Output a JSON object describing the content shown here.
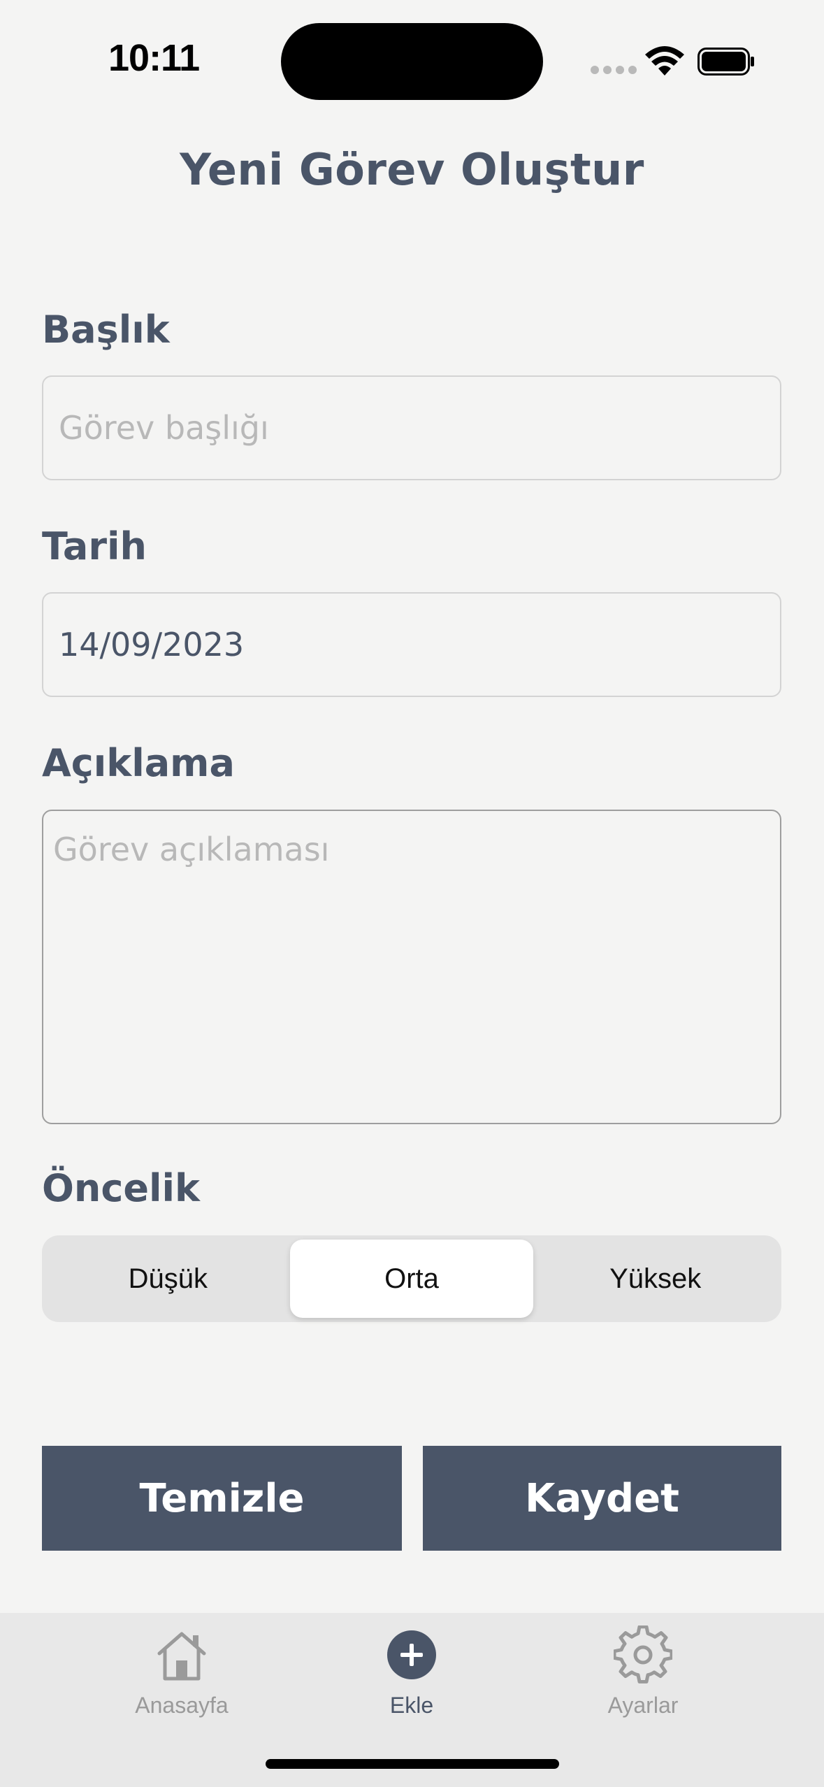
{
  "status_bar": {
    "time": "10:11"
  },
  "header": {
    "title": "Yeni Görev Oluştur"
  },
  "form": {
    "title_label": "Başlık",
    "title_placeholder": "Görev başlığı",
    "date_label": "Tarih",
    "date_value": "14/09/2023",
    "description_label": "Açıklama",
    "description_placeholder": "Görev açıklaması",
    "priority_label": "Öncelik",
    "priority_options": [
      "Düşük",
      "Orta",
      "Yüksek"
    ],
    "priority_selected": "Orta"
  },
  "actions": {
    "clear_label": "Temizle",
    "save_label": "Kaydet"
  },
  "tabbar": {
    "items": [
      {
        "label": "Anasayfa",
        "icon": "home-icon",
        "active": false
      },
      {
        "label": "Ekle",
        "icon": "plus-circle-icon",
        "active": true
      },
      {
        "label": "Ayarlar",
        "icon": "gear-icon",
        "active": false
      }
    ]
  },
  "colors": {
    "primary": "#4a5568",
    "background": "#f4f4f3",
    "inactive": "#9a9a9a"
  }
}
